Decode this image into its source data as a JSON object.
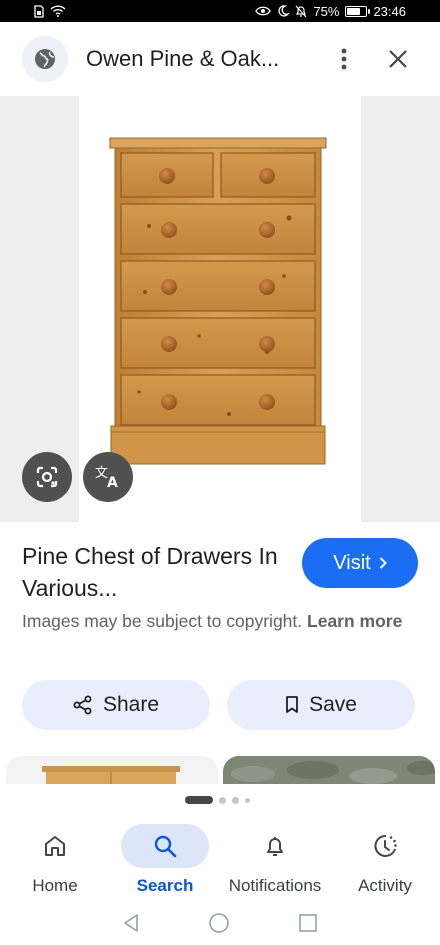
{
  "status_bar": {
    "battery_percent": "75%",
    "battery_level": 0.75,
    "time": "23:46",
    "left_icons": [
      "sim-icon",
      "wifi-icon"
    ],
    "right_icons": [
      "eye-comfort-icon",
      "moon-icon",
      "bell-off-icon",
      "battery-icon"
    ]
  },
  "header": {
    "site_icon": "globe-icon",
    "title": "Owen Pine & Oak...",
    "more_icon": "more-vert-icon",
    "close_icon": "close-icon"
  },
  "image": {
    "subject": "pine chest of drawers",
    "lens_icon": "google-lens-icon",
    "translate_icon": "translate-icon"
  },
  "info": {
    "title": "Pine Chest of Drawers In Various...",
    "visit_label": "Visit",
    "copyright_text": "Images may be subject to copyright.",
    "learn_more": "Learn more"
  },
  "actions": {
    "share_label": "Share",
    "save_label": "Save"
  },
  "pager": {
    "count": 4,
    "active": 0
  },
  "bottom_nav": {
    "items": [
      {
        "label": "Home",
        "icon": "home-icon",
        "active": false
      },
      {
        "label": "Search",
        "icon": "search-icon",
        "active": true
      },
      {
        "label": "Notifications",
        "icon": "bell-icon",
        "active": false
      },
      {
        "label": "Activity",
        "icon": "activity-icon",
        "active": false
      }
    ]
  },
  "colors": {
    "accent": "#1b6ef3",
    "active_nav": "#0b57d0",
    "pill_bg": "#e8eefb",
    "wood": "#c98d3e"
  }
}
